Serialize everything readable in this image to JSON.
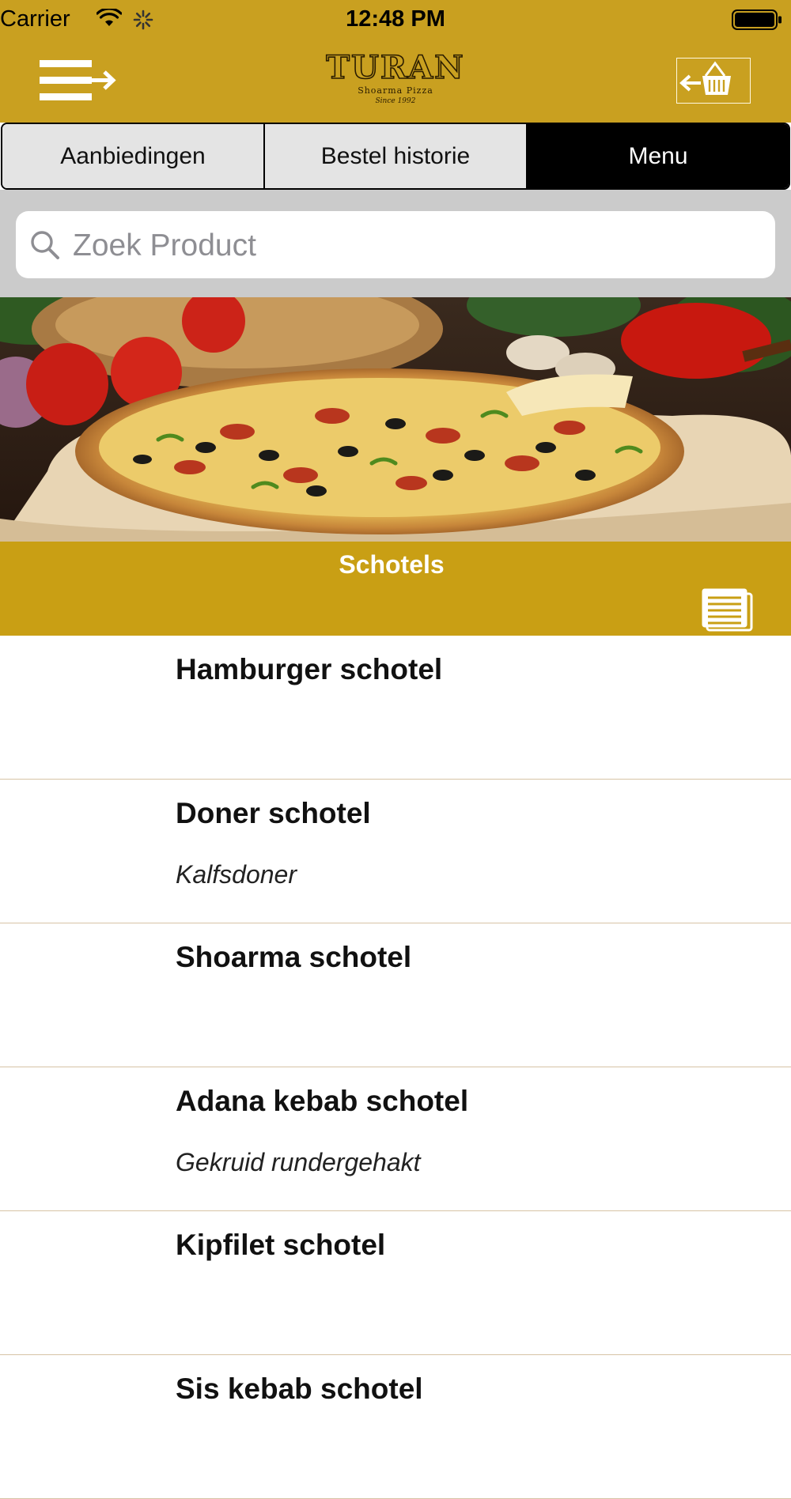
{
  "status_bar": {
    "carrier": "Carrier",
    "time": "12:48 PM"
  },
  "header": {
    "logo_title": "TURAN",
    "logo_subtitle": "Shoarma Pizza",
    "logo_since": "Since 1992",
    "menu_icon": "hamburger-arrow-icon",
    "basket_icon": "basket-icon",
    "background_color": "#c9a020"
  },
  "tabs": [
    {
      "label": "Aanbiedingen",
      "active": false
    },
    {
      "label": "Bestel historie",
      "active": false
    },
    {
      "label": "Menu",
      "active": true
    }
  ],
  "search": {
    "placeholder": "Zoek Product",
    "value": ""
  },
  "hero": {
    "icon": "pizza-photo"
  },
  "category": {
    "title": "Schotels",
    "icon": "document-list-icon",
    "color": "#c99f14"
  },
  "products": [
    {
      "name": "Hamburger schotel",
      "description": ""
    },
    {
      "name": "Doner schotel",
      "description": "Kalfsdoner"
    },
    {
      "name": "Shoarma schotel",
      "description": ""
    },
    {
      "name": "Adana kebab schotel",
      "description": "Gekruid rundergehakt"
    },
    {
      "name": "Kipfilet schotel",
      "description": ""
    },
    {
      "name": "Sis kebab schotel",
      "description": ""
    }
  ]
}
